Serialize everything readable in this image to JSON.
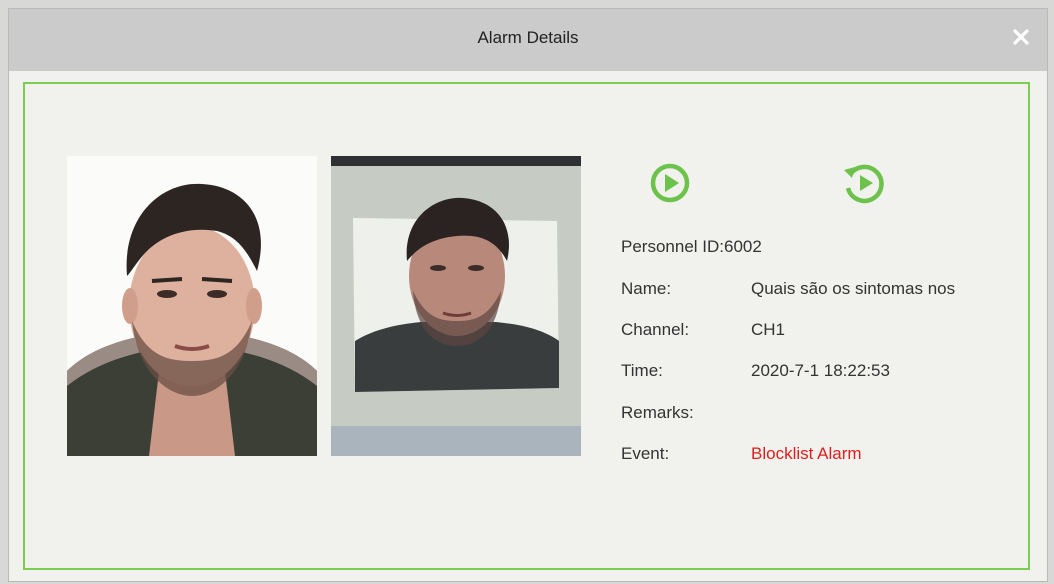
{
  "dialog": {
    "title": "Alarm Details"
  },
  "photos": {
    "registered": "registered-face-photo",
    "captured": "captured-face-photo"
  },
  "controls": {
    "play_icon": "play-icon",
    "replay_icon": "replay-icon",
    "accent_color": "#6cc24a"
  },
  "details": {
    "personnel_id_label": "Personnel ID:6002",
    "name_label": "Name:",
    "name_value": "Quais são os sintomas nos",
    "channel_label": "Channel:",
    "channel_value": "CH1",
    "time_label": "Time:",
    "time_value": "2020-7-1 18:22:53",
    "remarks_label": "Remarks:",
    "remarks_value": "",
    "event_label": "Event:",
    "event_value": "Blocklist Alarm",
    "event_color": "#e01e1e"
  }
}
